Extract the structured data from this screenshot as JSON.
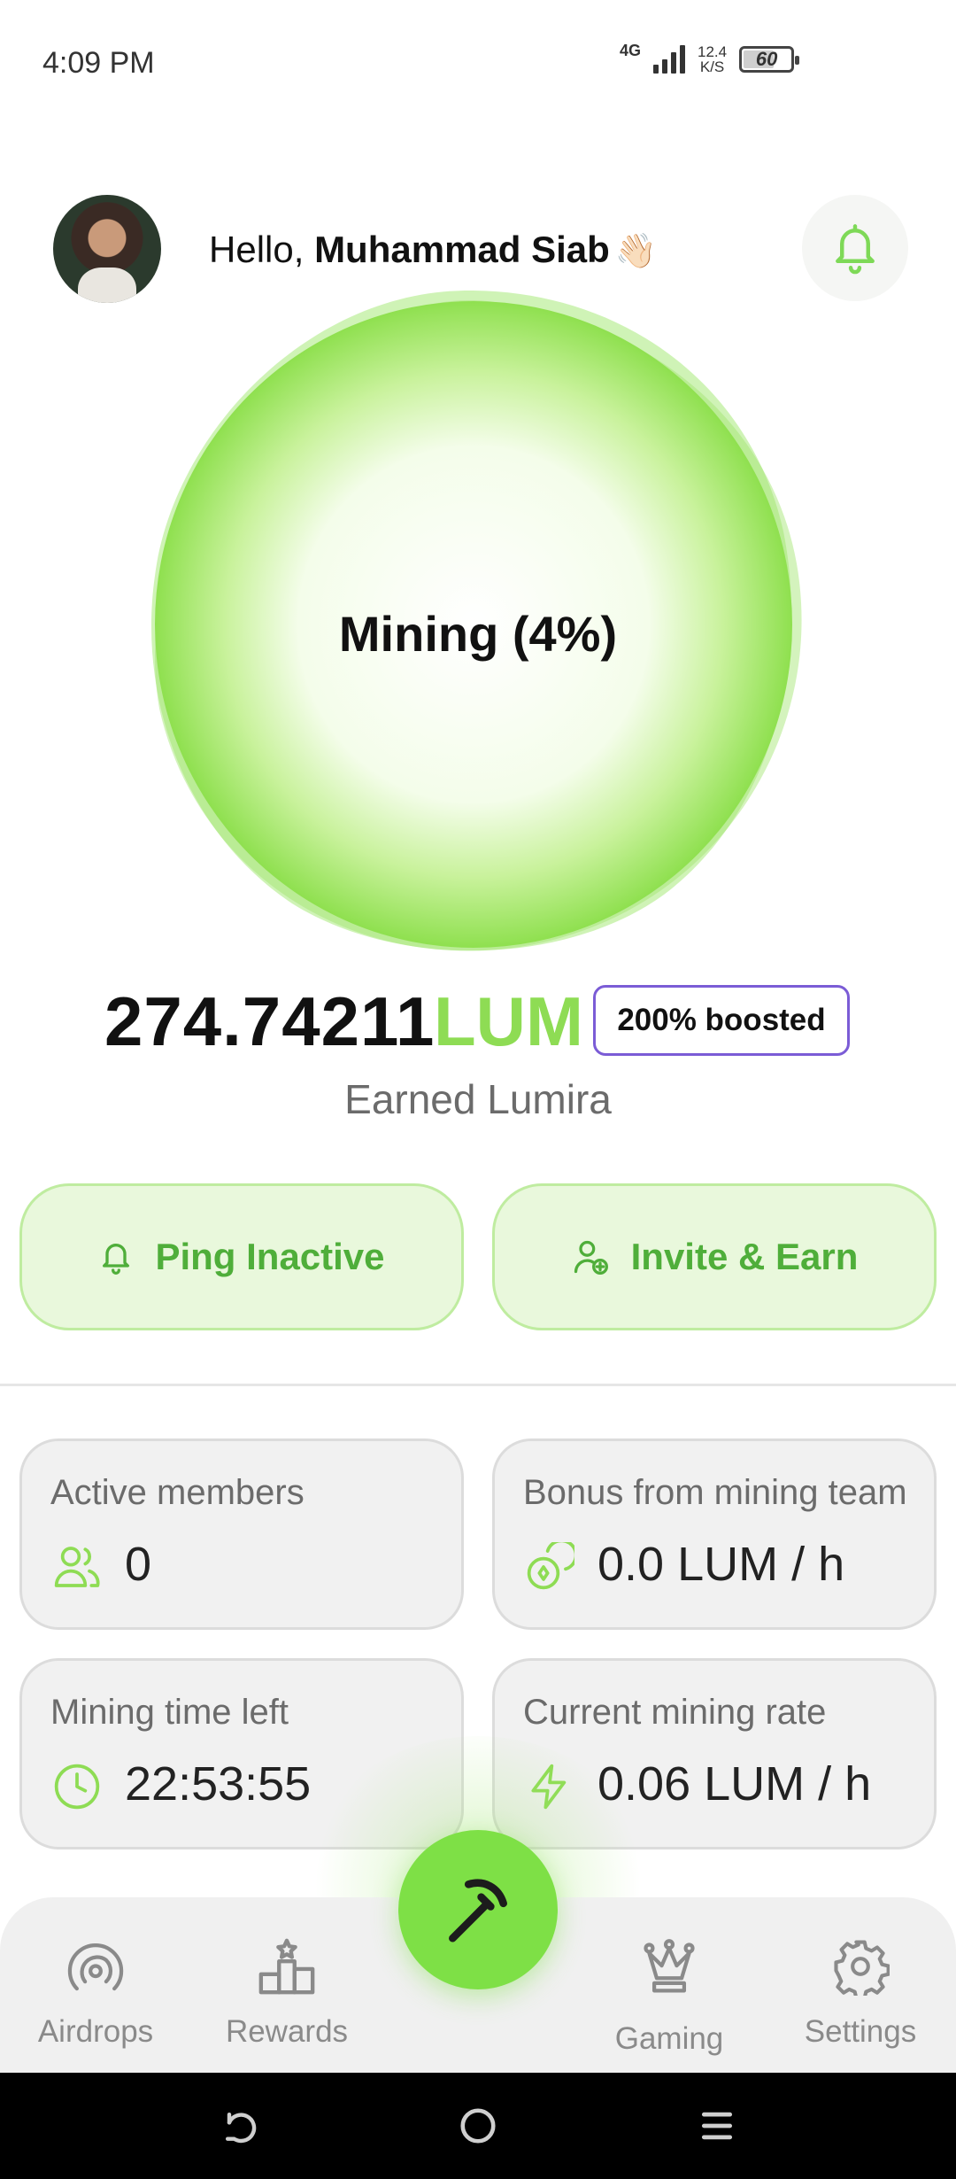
{
  "status_bar": {
    "time": "4:09 PM",
    "network": "4G",
    "speed_value": "12.4",
    "speed_unit": "K/S",
    "battery": "60"
  },
  "header": {
    "greeting_prefix": "Hello,",
    "user_name": "Muhammad Siab",
    "wave_emoji": "👋🏻",
    "notification_icon": "bell-icon"
  },
  "mining": {
    "label": "Mining (4%)",
    "progress_percent": 4
  },
  "balance": {
    "value": "274.74211",
    "unit": "LUM",
    "boost_badge": "200% boosted",
    "caption": "Earned Lumira"
  },
  "actions": {
    "ping_label": "Ping Inactive",
    "invite_label": "Invite & Earn"
  },
  "stats": [
    {
      "title": "Active members",
      "value": "0",
      "icon": "members-icon"
    },
    {
      "title": "Bonus from mining team",
      "value": "0.0 LUM / h",
      "icon": "coins-icon"
    },
    {
      "title": "Mining time left",
      "value": "22:53:55",
      "icon": "clock-icon"
    },
    {
      "title": "Current mining rate",
      "value": "0.06 LUM / h",
      "icon": "lightning-icon"
    }
  ],
  "bottom_nav": {
    "items": [
      {
        "label": "Airdrops",
        "icon": "airdrop-icon"
      },
      {
        "label": "Rewards",
        "icon": "podium-icon"
      },
      {
        "label": "Gaming",
        "icon": "crown-icon"
      },
      {
        "label": "Settings",
        "icon": "gear-icon"
      }
    ],
    "center_icon": "pickaxe-icon"
  },
  "colors": {
    "accent_green": "#8edc54",
    "button_green": "#7ee046",
    "boost_border": "#7b5cd6",
    "action_text": "#4fae3a"
  }
}
